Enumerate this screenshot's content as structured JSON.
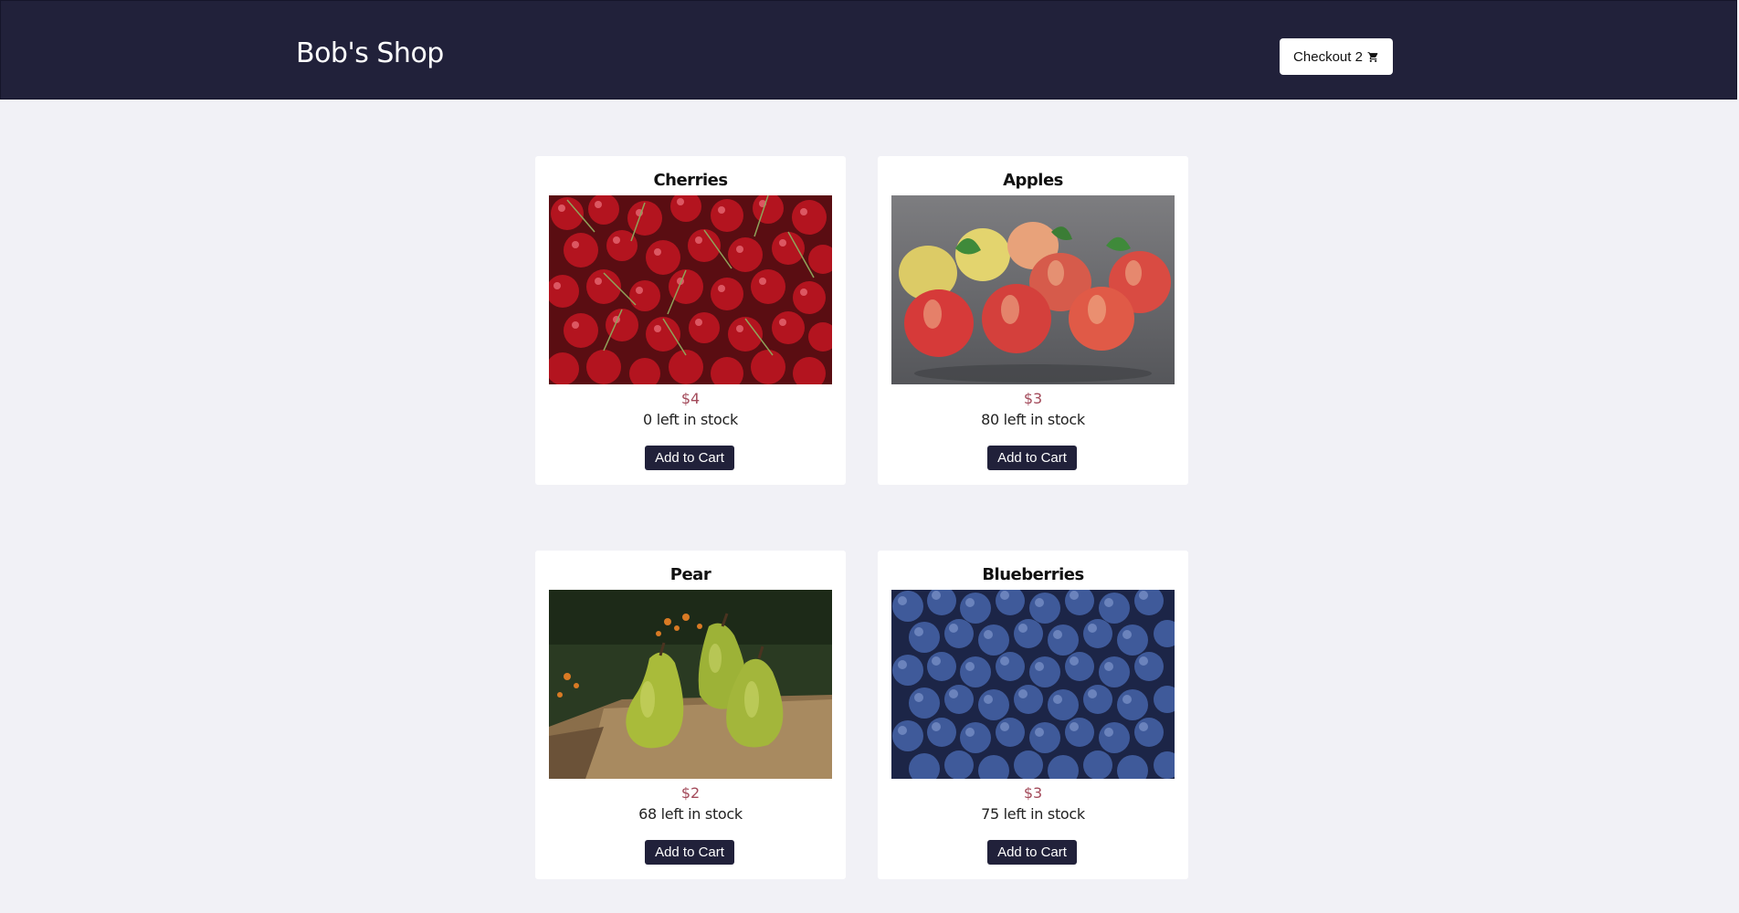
{
  "header": {
    "shop_name": "Bob's Shop",
    "checkout_label": "Checkout 2",
    "cart_icon": "cart-icon"
  },
  "colors": {
    "header_bg": "#21213a",
    "page_bg": "#f1f1f6",
    "price": "#a34a5a",
    "button_bg": "#21213a"
  },
  "products": [
    {
      "name": "Cherries",
      "price": "$4",
      "stock": "0 left in stock",
      "button": "Add to Cart",
      "image": "cherries photo"
    },
    {
      "name": "Apples",
      "price": "$3",
      "stock": "80 left in stock",
      "button": "Add to Cart",
      "image": "apples photo"
    },
    {
      "name": "Pear",
      "price": "$2",
      "stock": "68 left in stock",
      "button": "Add to Cart",
      "image": "pears photo"
    },
    {
      "name": "Blueberries",
      "price": "$3",
      "stock": "75 left in stock",
      "button": "Add to Cart",
      "image": "blueberries photo"
    }
  ]
}
